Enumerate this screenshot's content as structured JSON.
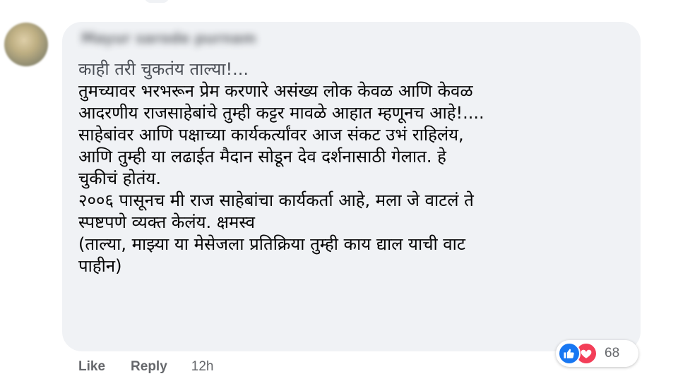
{
  "comment": {
    "author": "Mayur sarode purnam",
    "lines": [
      "काही तरी चुकतंय ताल्या!...",
      "तुमच्यावर भरभरून प्रेम करणारे असंख्य लोक केवळ आणि केवळ",
      "आदरणीय राजसाहेबांचे तुम्ही कट्टर मावळे आहात म्हणूनच आहे!....",
      "साहेबांवर आणि पक्षाच्या कार्यकर्त्यांवर आज संकट उभं राहिलंय,",
      "आणि तुम्ही या लढाईत मैदान सोडून देव दर्शनासाठी गेलात. हे",
      "चुकीचं होतंय.",
      "२००६ पासूनच मी राज साहेबांचा कार्यकर्ता आहे, मला जे वाटलं ते",
      "स्पष्टपणे व्यक्त केलंय. क्षमस्व",
      "(ताल्या, माझ्या या मेसेजला प्रतिक्रिया तुम्ही काय द्याल याची वाट",
      "पाहीन)"
    ]
  },
  "actions": {
    "like_label": "Like",
    "reply_label": "Reply",
    "timestamp": "12h"
  },
  "reactions": {
    "icons": [
      "like-reaction-icon",
      "love-reaction-icon"
    ],
    "count": "68",
    "colors": {
      "like": "#1877f2",
      "love": "#f33e58"
    }
  },
  "colors": {
    "bubble_background": "#f0f2f5",
    "text": "#050505",
    "secondary_text": "#65676b"
  }
}
